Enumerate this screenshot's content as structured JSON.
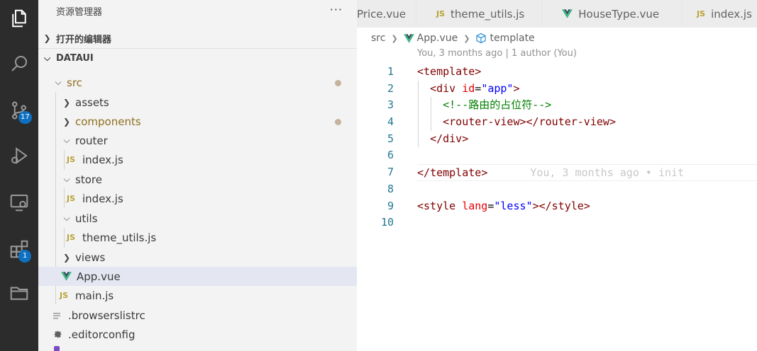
{
  "activity_bar": {
    "scm_badge": "17",
    "extensions_badge": "1"
  },
  "sidebar": {
    "title": "资源管理器",
    "more_label": "···",
    "open_editors_label": "打开的编辑器",
    "project_label": "DATAUI",
    "tree": [
      {
        "label": "src",
        "type": "folder",
        "expanded": true,
        "modified": true
      },
      {
        "label": "assets",
        "type": "folder",
        "expanded": false
      },
      {
        "label": "components",
        "type": "folder",
        "expanded": false,
        "modified": true
      },
      {
        "label": "router",
        "type": "folder",
        "expanded": true
      },
      {
        "label": "index.js",
        "type": "js"
      },
      {
        "label": "store",
        "type": "folder",
        "expanded": true
      },
      {
        "label": "index.js",
        "type": "js"
      },
      {
        "label": "utils",
        "type": "folder",
        "expanded": true
      },
      {
        "label": "theme_utils.js",
        "type": "js"
      },
      {
        "label": "views",
        "type": "folder",
        "expanded": false
      },
      {
        "label": "App.vue",
        "type": "vue",
        "selected": true
      },
      {
        "label": "main.js",
        "type": "js"
      },
      {
        "label": ".browserslistrc",
        "type": "config"
      },
      {
        "label": ".editorconfig",
        "type": "gear"
      }
    ],
    "js_badge": "JS"
  },
  "tabs": [
    {
      "label": "Price.vue",
      "icon": "vue-icon"
    },
    {
      "label": "theme_utils.js",
      "icon": "js-icon"
    },
    {
      "label": "HouseType.vue",
      "icon": "vue-icon"
    },
    {
      "label": "index.js",
      "icon": "js-icon"
    }
  ],
  "breadcrumb": {
    "folder": "src",
    "file": "App.vue",
    "symbol": "template"
  },
  "blame_header": "You, 3 months ago | 1 author (You)",
  "editor": {
    "line_numbers": [
      "1",
      "2",
      "3",
      "4",
      "5",
      "6",
      "7",
      "8",
      "9",
      "10"
    ],
    "inline_blame": "You, 3 months ago • init",
    "code": {
      "l1_open": "<",
      "l1_tag": "template",
      "l1_close": ">",
      "l2_open": "<",
      "l2_tag": "div",
      "l2_attr": "id",
      "l2_eq": "=",
      "l2_val": "\"app\"",
      "l2_close": ">",
      "l3_comment": "<!--路由的占位符-->",
      "l4_open": "<",
      "l4_tag": "router-view",
      "l4_mid": "></",
      "l4_tag2": "router-view",
      "l4_close": ">",
      "l5_open": "</",
      "l5_tag": "div",
      "l5_close": ">",
      "l7_open": "</",
      "l7_tag": "template",
      "l7_close": ">",
      "l9_open": "<",
      "l9_tag": "style",
      "l9_attr": "lang",
      "l9_eq": "=",
      "l9_val": "\"less\"",
      "l9_mid": "></",
      "l9_tag2": "style",
      "l9_close": ">"
    }
  },
  "colors": {
    "activity_bg": "#2c2c2c",
    "sidebar_bg": "#f3f3f3",
    "badge": "#0e70c0",
    "vue_green": "#41b883",
    "js_yellow": "#b8a136"
  }
}
